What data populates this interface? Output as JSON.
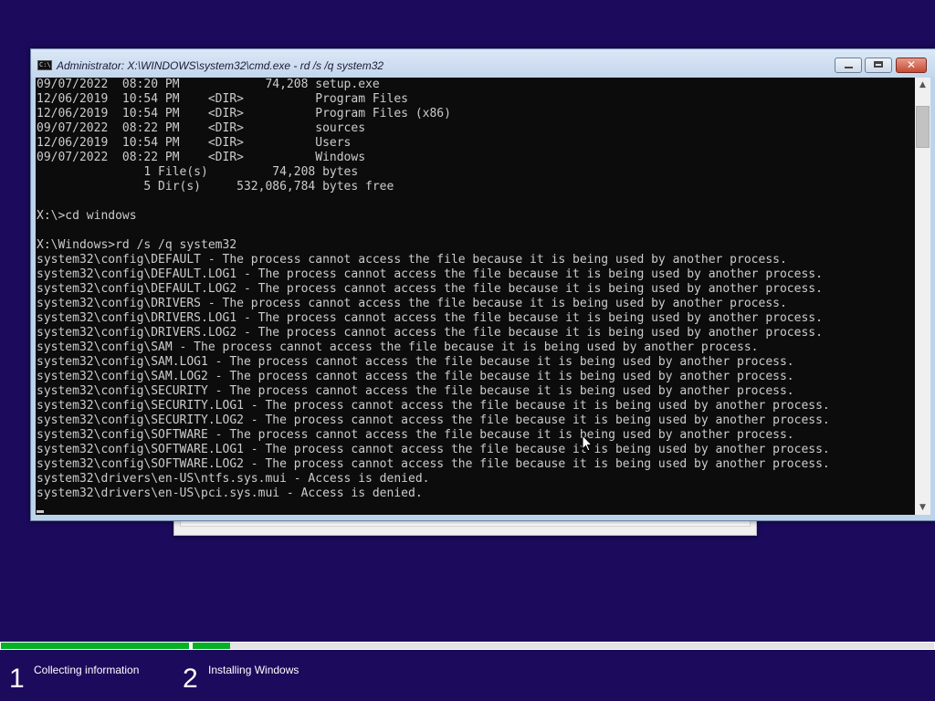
{
  "window": {
    "title": "Administrator: X:\\WINDOWS\\system32\\cmd.exe - rd  /s /q system32",
    "icon": "cmd-icon",
    "icon_prompt": "C:\\"
  },
  "console": {
    "lines": [
      "09/07/2022  08:20 PM            74,208 setup.exe",
      "12/06/2019  10:54 PM    <DIR>          Program Files",
      "12/06/2019  10:54 PM    <DIR>          Program Files (x86)",
      "09/07/2022  08:22 PM    <DIR>          sources",
      "12/06/2019  10:54 PM    <DIR>          Users",
      "09/07/2022  08:22 PM    <DIR>          Windows",
      "               1 File(s)         74,208 bytes",
      "               5 Dir(s)     532,086,784 bytes free",
      "",
      "X:\\>cd windows",
      "",
      "X:\\Windows>rd /s /q system32",
      "system32\\config\\DEFAULT - The process cannot access the file because it is being used by another process.",
      "system32\\config\\DEFAULT.LOG1 - The process cannot access the file because it is being used by another process.",
      "system32\\config\\DEFAULT.LOG2 - The process cannot access the file because it is being used by another process.",
      "system32\\config\\DRIVERS - The process cannot access the file because it is being used by another process.",
      "system32\\config\\DRIVERS.LOG1 - The process cannot access the file because it is being used by another process.",
      "system32\\config\\DRIVERS.LOG2 - The process cannot access the file because it is being used by another process.",
      "system32\\config\\SAM - The process cannot access the file because it is being used by another process.",
      "system32\\config\\SAM.LOG1 - The process cannot access the file because it is being used by another process.",
      "system32\\config\\SAM.LOG2 - The process cannot access the file because it is being used by another process.",
      "system32\\config\\SECURITY - The process cannot access the file because it is being used by another process.",
      "system32\\config\\SECURITY.LOG1 - The process cannot access the file because it is being used by another process.",
      "system32\\config\\SECURITY.LOG2 - The process cannot access the file because it is being used by another process.",
      "system32\\config\\SOFTWARE - The process cannot access the file because it is being used by another process.",
      "system32\\config\\SOFTWARE.LOG1 - The process cannot access the file because it is being used by another process.",
      "system32\\config\\SOFTWARE.LOG2 - The process cannot access the file because it is being used by another process.",
      "system32\\drivers\\en-US\\ntfs.sys.mui - Access is denied.",
      "system32\\drivers\\en-US\\pci.sys.mui - Access is denied."
    ]
  },
  "scrollbar": {
    "up_glyph": "▲",
    "down_glyph": "▼"
  },
  "caption_buttons": {
    "close_glyph": "✕"
  },
  "setup_progress": {
    "colors": {
      "fill": "#06b025",
      "background": "#1c0a5c"
    },
    "steps": [
      {
        "number": "1",
        "label": "Collecting information",
        "progress": 1.0
      },
      {
        "number": "2",
        "label": "Installing Windows",
        "progress": 0.05
      }
    ]
  }
}
